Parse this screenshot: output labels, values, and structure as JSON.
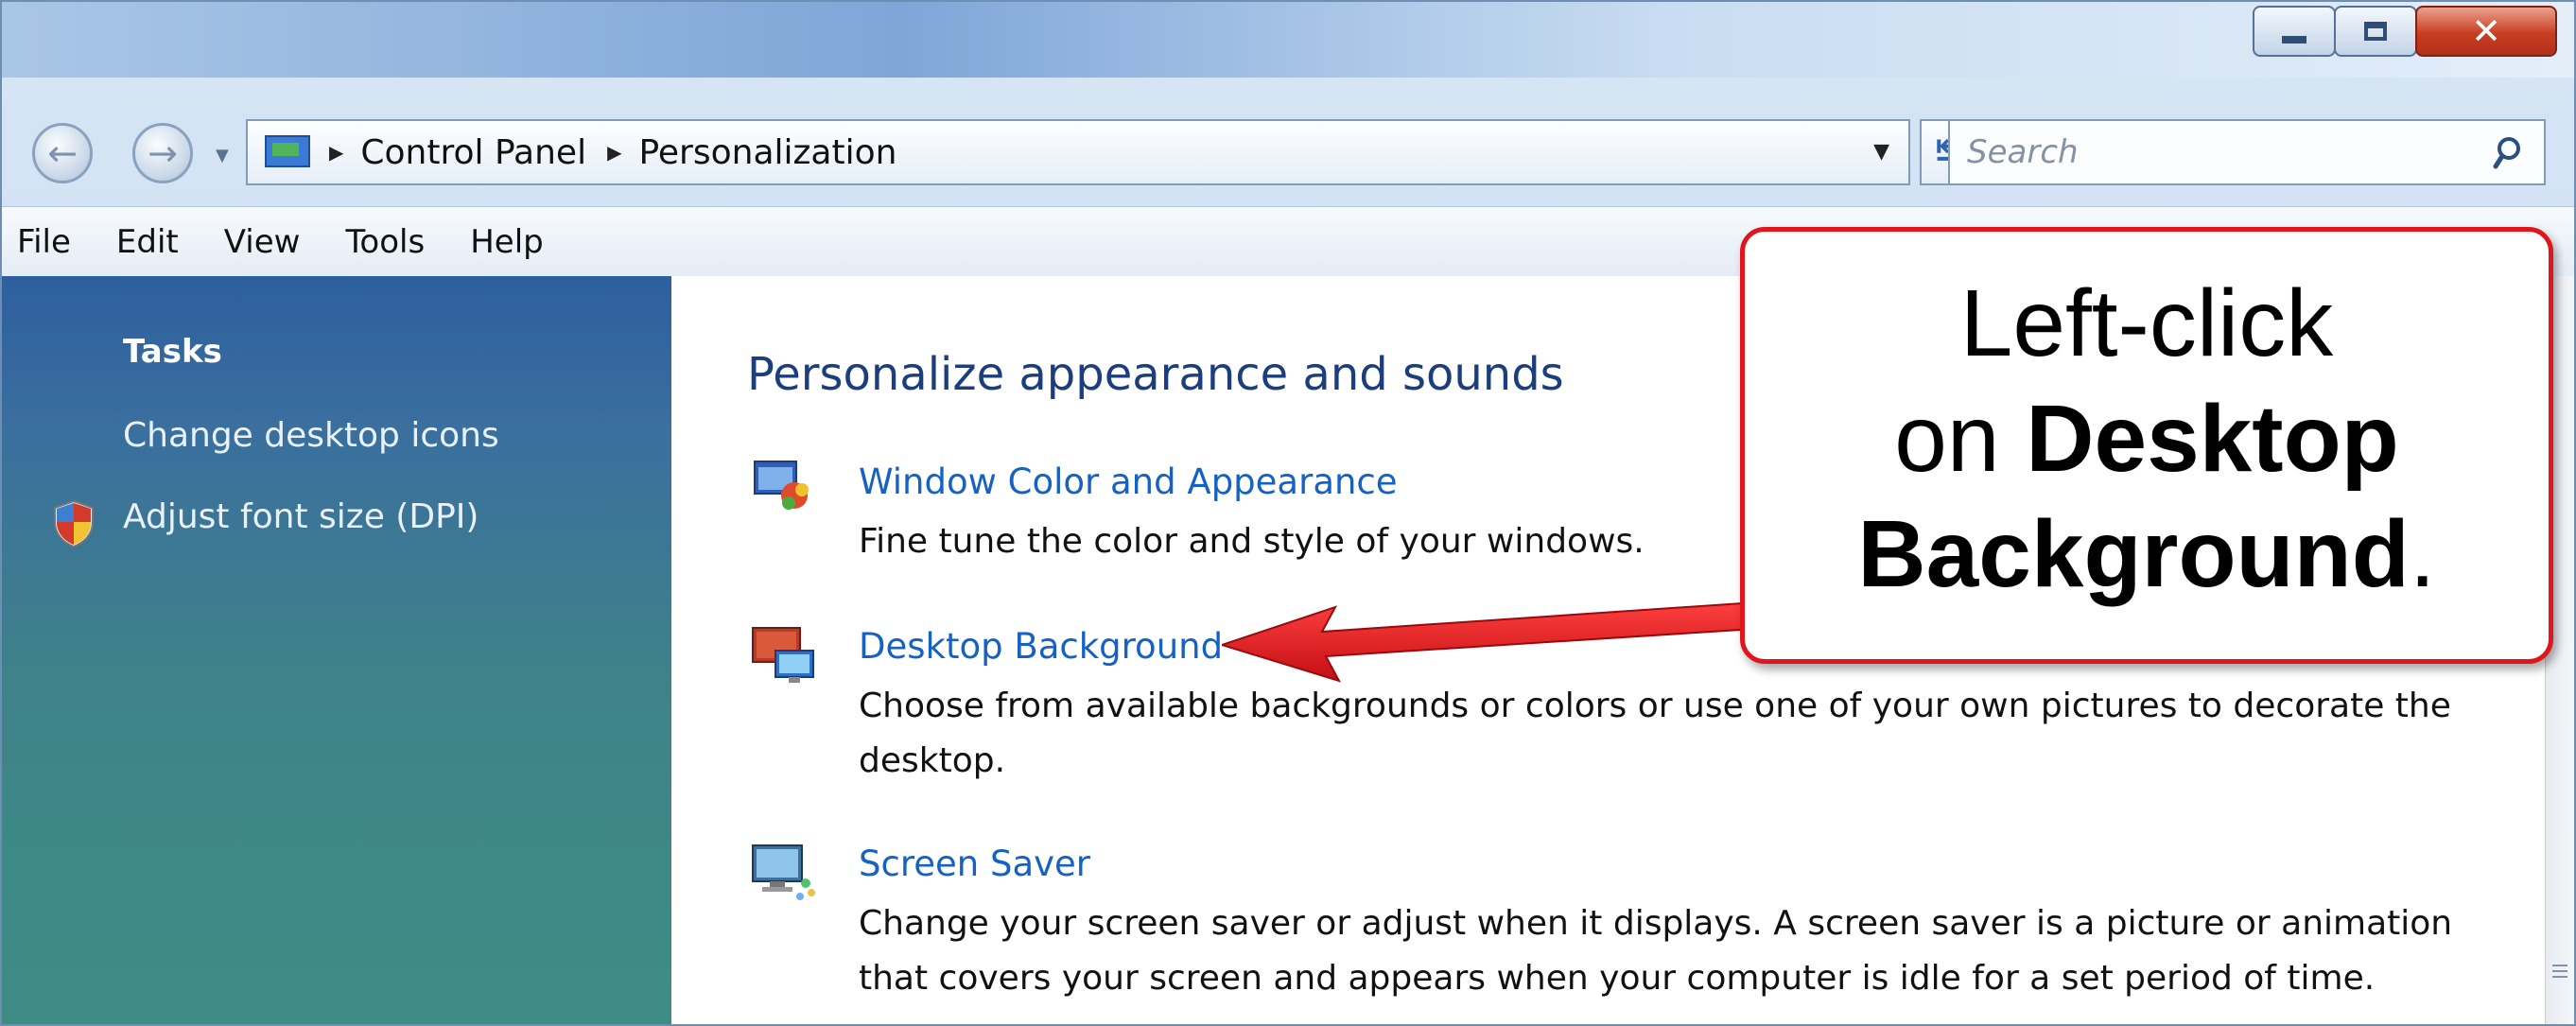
{
  "breadcrumb": [
    "Control Panel",
    "Personalization"
  ],
  "search": {
    "placeholder": "Search"
  },
  "menu": [
    "File",
    "Edit",
    "View",
    "Tools",
    "Help"
  ],
  "sidebar": {
    "title": "Tasks",
    "items": [
      {
        "label": "Change desktop icons",
        "icon": ""
      },
      {
        "label": "Adjust font size (DPI)",
        "icon": "shield-icon"
      }
    ]
  },
  "main": {
    "heading": "Personalize appearance and sounds",
    "items": [
      {
        "title": "Window Color and Appearance",
        "desc": "Fine tune the color and style of your windows.",
        "icon": "window-color-icon"
      },
      {
        "title": "Desktop Background",
        "desc": "Choose from available backgrounds or colors or use one of your own pictures to decorate the desktop.",
        "icon": "desktop-background-icon"
      },
      {
        "title": "Screen Saver",
        "desc": "Change your screen saver or adjust when it displays. A screen saver is a picture or animation that covers your screen and appears when your computer is idle for a set period of time.",
        "icon": "screen-saver-icon"
      }
    ]
  },
  "callout": {
    "line1": "Left-click",
    "line2_prefix": "on ",
    "line2_bold": "Desktop",
    "line3_bold": "Background",
    "line3_suffix": "."
  },
  "colors": {
    "callout_border": "#e0161c",
    "link": "#1562c4",
    "heading": "#1d3e7d"
  }
}
